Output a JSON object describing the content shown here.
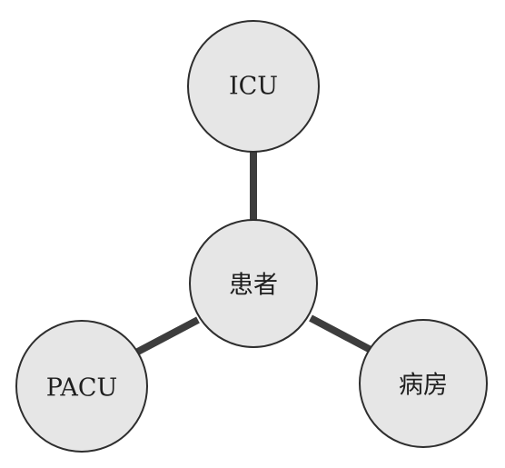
{
  "diagram": {
    "center": {
      "label": "患者"
    },
    "top": {
      "label": "ICU"
    },
    "left": {
      "label": "PACU"
    },
    "right": {
      "label": "病房"
    }
  },
  "colors": {
    "node_fill": "#e6e6e6",
    "node_stroke": "#2e2e2e",
    "connector": "#3d3d3d",
    "text": "#1e1e1e"
  }
}
